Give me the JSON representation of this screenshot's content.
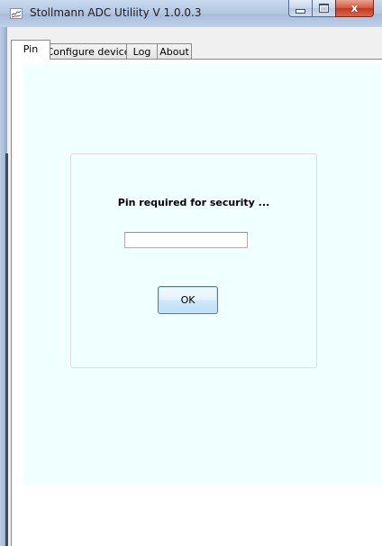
{
  "window": {
    "title": "Stollmann ADC  Utiliity V 1.0.0.3",
    "icon": "app-icon",
    "caption_buttons": {
      "minimize_icon": "minimize-icon",
      "maximize_icon": "maximize-icon",
      "close_icon": "close-icon",
      "close_glyph": "x"
    }
  },
  "tabs": [
    {
      "label": "Pin",
      "selected": true
    },
    {
      "label": "Configure device",
      "selected": false
    },
    {
      "label": "Log",
      "selected": false
    },
    {
      "label": "About",
      "selected": false
    }
  ],
  "pin_page": {
    "prompt": "Pin required for security ...",
    "pin_input": {
      "value": "",
      "placeholder": ""
    },
    "ok_label": "OK"
  },
  "colors": {
    "panel_background": "#f0ffff",
    "ok_button_border": "#3c7fb1",
    "close_button": "#c7361b"
  }
}
